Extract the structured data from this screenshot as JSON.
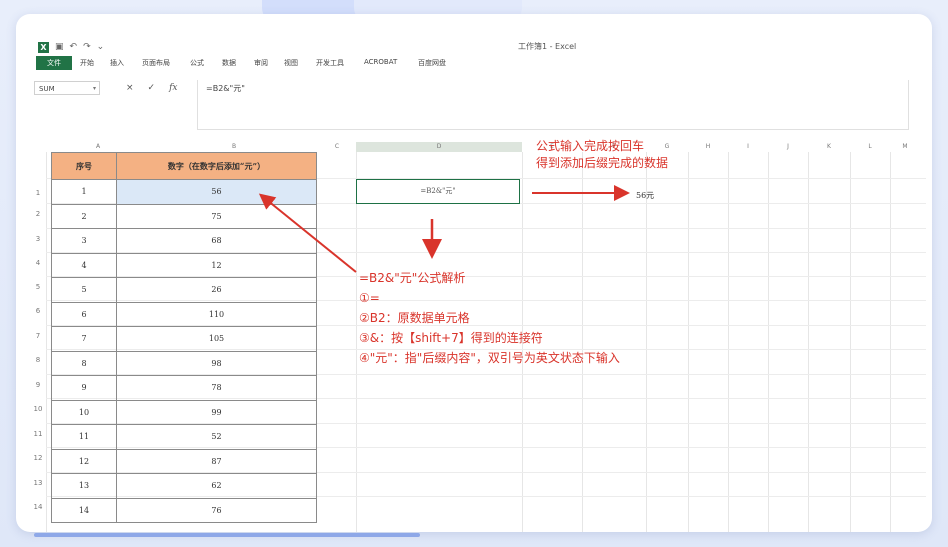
{
  "window": {
    "title": "工作簿1 - Excel"
  },
  "ribbon": {
    "file_label": "文件",
    "tabs": [
      "开始",
      "插入",
      "页面布局",
      "公式",
      "数据",
      "审阅",
      "视图",
      "开发工具",
      "ACROBAT",
      "百度网盘"
    ]
  },
  "formula_bar": {
    "name_box": "SUM",
    "cancel_icon": "×",
    "enter_icon": "✓",
    "fx_label": "fx",
    "content": "=B2&\"元\""
  },
  "columns": [
    "A",
    "B",
    "C",
    "D",
    "E",
    "F",
    "G",
    "H",
    "I",
    "J",
    "K",
    "L",
    "M"
  ],
  "rows": [
    "1",
    "2",
    "3",
    "4",
    "5",
    "6",
    "7",
    "8",
    "9",
    "10",
    "11",
    "12",
    "13",
    "14"
  ],
  "table": {
    "headers": [
      "序号",
      "数字（在数字后添加“元”）"
    ],
    "rows": [
      [
        "1",
        "56"
      ],
      [
        "2",
        "75"
      ],
      [
        "3",
        "68"
      ],
      [
        "4",
        "12"
      ],
      [
        "5",
        "26"
      ],
      [
        "6",
        "110"
      ],
      [
        "7",
        "105"
      ],
      [
        "8",
        "98"
      ],
      [
        "9",
        "78"
      ],
      [
        "10",
        "99"
      ],
      [
        "11",
        "52"
      ],
      [
        "12",
        "87"
      ],
      [
        "13",
        "62"
      ],
      [
        "14",
        "76"
      ]
    ]
  },
  "cell_d2": {
    "value": "=B2&\"元\""
  },
  "result_cell": {
    "value": "56元"
  },
  "annotation_top": {
    "line1": "公式输入完成按回车",
    "line2": "得到添加后缀完成的数据"
  },
  "annotation_main": {
    "title": "=B2&\"元\"公式解析",
    "item1": "①=",
    "item2": "②B2：原数据单元格",
    "item3": "③&：按【shift+7】得到的连接符",
    "item4": "④\"元\"：指\"后缀内容\"，双引号为英文状态下输入"
  },
  "colors": {
    "accent": "#217346",
    "header_fill": "#f4b183",
    "annotation": "#d9342b",
    "selected_cell": "#dbe8f7"
  }
}
